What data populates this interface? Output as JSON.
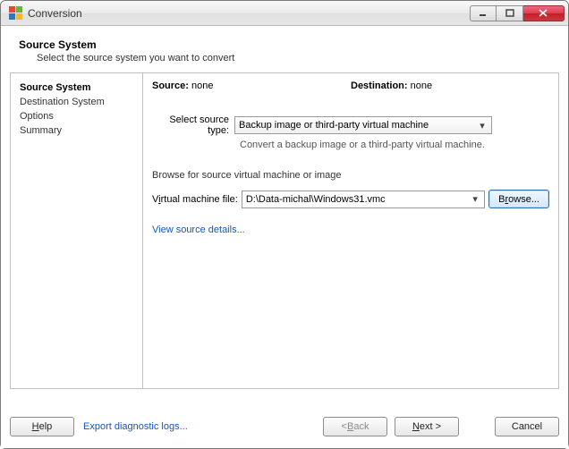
{
  "window": {
    "title": "Conversion"
  },
  "header": {
    "title": "Source System",
    "subtitle": "Select the source system you want to convert"
  },
  "nav": {
    "items": [
      {
        "label": "Source System",
        "active": true
      },
      {
        "label": "Destination System",
        "active": false
      },
      {
        "label": "Options",
        "active": false
      },
      {
        "label": "Summary",
        "active": false
      }
    ]
  },
  "page": {
    "source_label": "Source:",
    "source_value": "none",
    "destination_label": "Destination:",
    "destination_value": "none",
    "select_type_label": "Select source type:",
    "select_type_value": "Backup image or third-party virtual machine",
    "select_type_hint": "Convert a backup image or a third-party virtual machine.",
    "group_label": "Browse for source virtual machine or image",
    "vm_file_label_pre": "V",
    "vm_file_label_u": "i",
    "vm_file_label_post": "rtual machine file:",
    "vm_file_value": "D:\\Data-michal\\Windows31.vmc",
    "browse_pre": "B",
    "browse_u": "r",
    "browse_post": "owse...",
    "view_details": "View source details..."
  },
  "footer": {
    "help_u": "H",
    "help_post": "elp",
    "export_logs": "Export diagnostic logs...",
    "back_pre": "< ",
    "back_u": "B",
    "back_post": "ack",
    "next_u": "N",
    "next_post": "ext >",
    "cancel": "Cancel"
  }
}
